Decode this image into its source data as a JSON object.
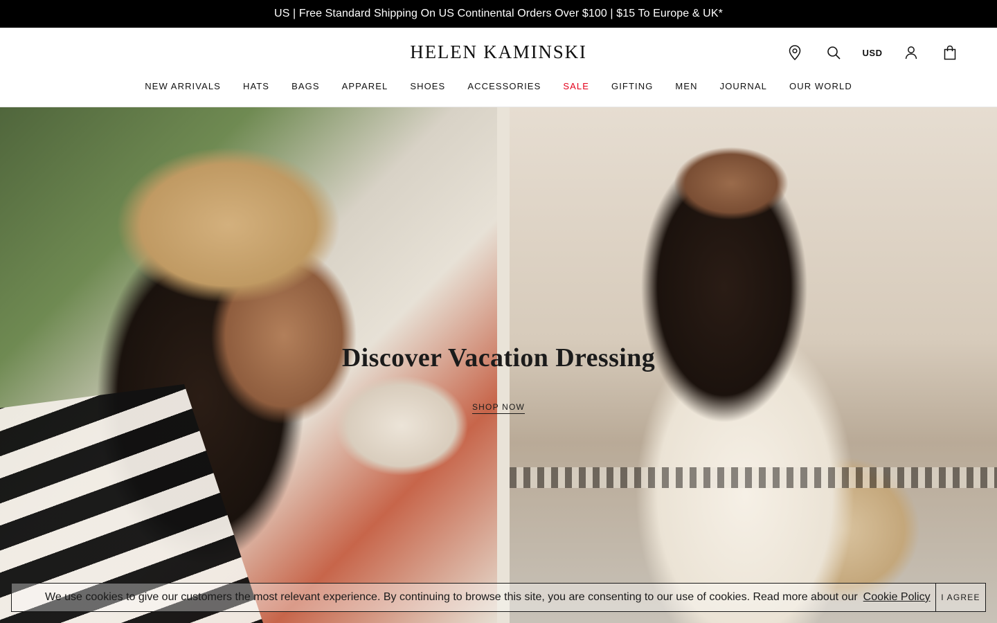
{
  "promo_bar": {
    "text": "US | Free Standard Shipping On US Continental Orders Over $100 | $15 To Europe & UK*"
  },
  "header": {
    "logo": "HELEN KAMINSKI",
    "utility": {
      "store_locator_icon": "map-pin-icon",
      "search_icon": "search-icon",
      "currency": "USD",
      "account_icon": "user-icon",
      "bag_icon": "shopping-bag-icon"
    },
    "nav": [
      {
        "label": "NEW ARRIVALS"
      },
      {
        "label": "HATS"
      },
      {
        "label": "BAGS"
      },
      {
        "label": "APPAREL"
      },
      {
        "label": "SHOES"
      },
      {
        "label": "ACCESSORIES"
      },
      {
        "label": "SALE",
        "color": "#e3001b"
      },
      {
        "label": "GIFTING"
      },
      {
        "label": "MEN"
      },
      {
        "label": "JOURNAL"
      },
      {
        "label": "OUR WORLD"
      }
    ]
  },
  "hero": {
    "title": "Discover Vacation Dressing",
    "cta": "SHOP NOW"
  },
  "cookie_banner": {
    "text": "We use cookies to give our customers the most relevant experience. By continuing to browse this site, you are consenting to our use of cookies. Read more about our",
    "link": "Cookie Policy",
    "agree_button": "I AGREE"
  },
  "colors": {
    "promo_background": "#000000",
    "sale_accent": "#e3001b",
    "text": "#111111"
  }
}
